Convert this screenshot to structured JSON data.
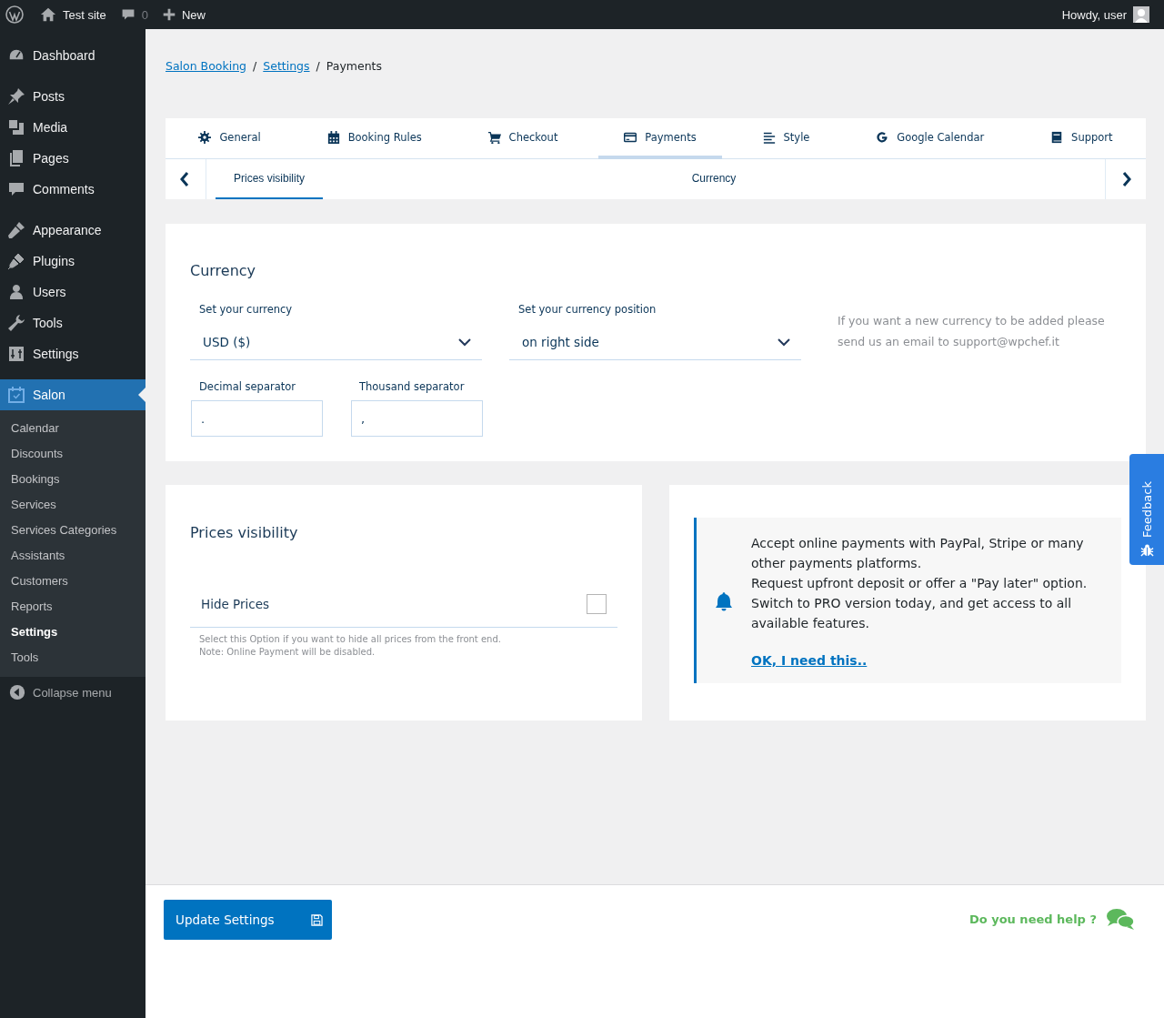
{
  "admin_bar": {
    "site": "Test site",
    "comments": "0",
    "new": "New",
    "greeting": "Howdy, user"
  },
  "sidebar": {
    "groups": [
      [
        {
          "label": "Dashboard",
          "selected": false
        }
      ],
      [
        {
          "label": "Posts",
          "selected": false
        },
        {
          "label": "Media",
          "selected": false
        },
        {
          "label": "Pages",
          "selected": false
        },
        {
          "label": "Comments",
          "selected": false
        }
      ],
      [
        {
          "label": "Appearance",
          "selected": false
        },
        {
          "label": "Plugins",
          "selected": false
        },
        {
          "label": "Users",
          "selected": false
        },
        {
          "label": "Tools",
          "selected": false
        },
        {
          "label": "Settings",
          "selected": false
        }
      ],
      [
        {
          "label": "Salon",
          "selected": true,
          "children": [
            {
              "label": "Calendar",
              "selected": false
            },
            {
              "label": "Discounts",
              "selected": false
            },
            {
              "label": "Bookings",
              "selected": false
            },
            {
              "label": "Services",
              "selected": false
            },
            {
              "label": "Services Categories",
              "selected": false
            },
            {
              "label": "Assistants",
              "selected": false
            },
            {
              "label": "Customers",
              "selected": false
            },
            {
              "label": "Reports",
              "selected": false
            },
            {
              "label": "Settings",
              "selected": true
            },
            {
              "label": "Tools",
              "selected": false
            }
          ]
        }
      ]
    ],
    "collapse": "Collapse menu"
  },
  "breadcrumb": [
    {
      "label": "Salon Booking",
      "link": true
    },
    {
      "label": "/",
      "link": false
    },
    {
      "label": "Settings",
      "link": true
    },
    {
      "label": "/",
      "link": false
    },
    {
      "label": "Payments",
      "link": false
    }
  ],
  "tabs": [
    {
      "label": "General",
      "selected": false
    },
    {
      "label": "Booking Rules",
      "selected": false
    },
    {
      "label": "Checkout",
      "selected": false
    },
    {
      "label": "Payments",
      "selected": true
    },
    {
      "label": "Style",
      "selected": false
    },
    {
      "label": "Google Calendar",
      "selected": false
    },
    {
      "label": "Support",
      "selected": false
    }
  ],
  "subtabs": [
    {
      "label": "Prices visibility",
      "selected": true
    },
    {
      "label": "Currency",
      "selected": false
    }
  ],
  "currency": {
    "title": "Currency",
    "selects": [
      {
        "label": "Set your currency",
        "value": "USD ($)"
      },
      {
        "label": "Set your currency position",
        "value": "on right side"
      }
    ],
    "note": "If you want a new currency to be added please send us an email to support@wpchef.it",
    "inputs": [
      {
        "label": "Decimal separator",
        "value": "."
      },
      {
        "label": "Thousand separator",
        "value": ","
      }
    ]
  },
  "prices_visibility": {
    "title": "Prices visibility",
    "option": {
      "label": "Hide Prices",
      "checked": false
    },
    "help": [
      "Select this Option if you want to hide all prices from the front end.",
      "Note: Online Payment will be disabled."
    ]
  },
  "promo": {
    "paragraphs": [
      "Accept online payments with PayPal, Stripe or many other payments platforms.",
      "Request upfront deposit or offer a \"Pay later\" option. Switch to PRO version today, and get access to all available features."
    ],
    "link": "OK, I need this.."
  },
  "footer": {
    "button": "Update Settings",
    "help": "Do you need help ?"
  },
  "feedback": "Feedback"
}
